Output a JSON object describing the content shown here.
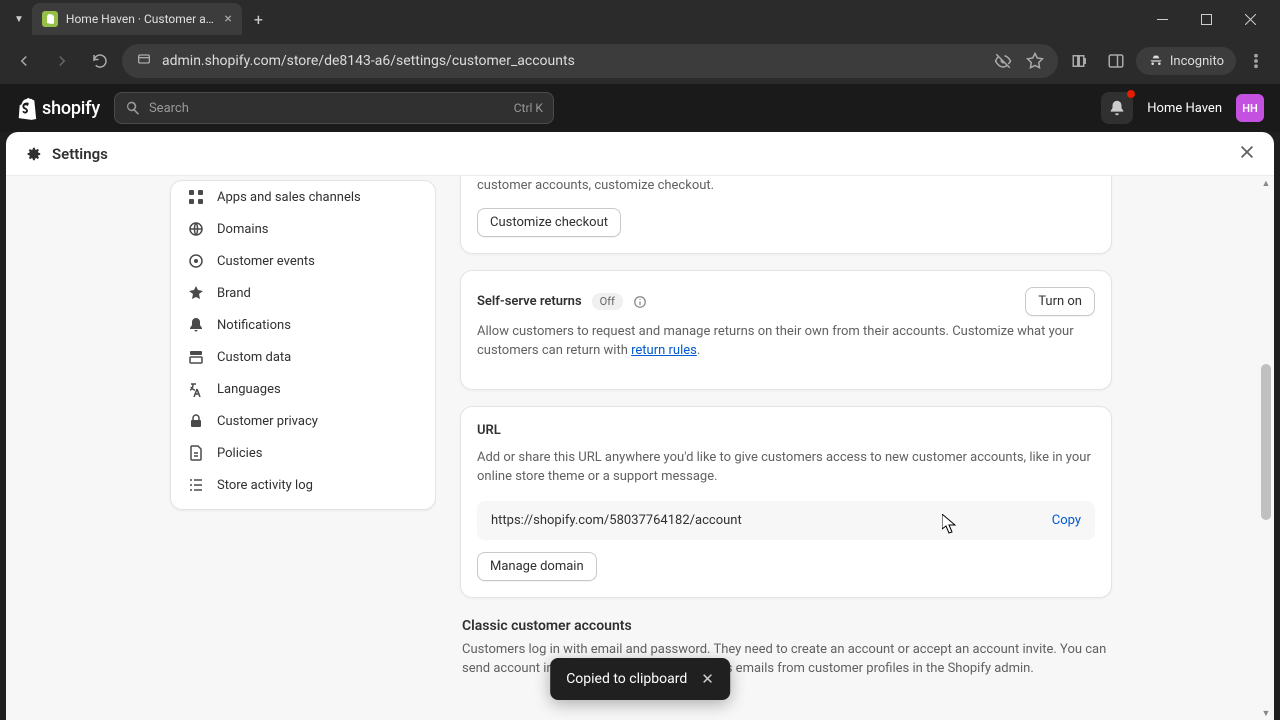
{
  "browser": {
    "tab_title": "Home Haven · Customer accou",
    "url": "admin.shopify.com/store/de8143-a6/settings/customer_accounts",
    "incognito_label": "Incognito"
  },
  "topbar": {
    "logo_text": "shopify",
    "search_placeholder": "Search",
    "search_shortcut": "Ctrl K",
    "store_name": "Home Haven",
    "avatar_initials": "HH"
  },
  "settings": {
    "title": "Settings"
  },
  "sidebar": {
    "items": [
      {
        "label": "Apps and sales channels"
      },
      {
        "label": "Domains"
      },
      {
        "label": "Customer events"
      },
      {
        "label": "Brand"
      },
      {
        "label": "Notifications"
      },
      {
        "label": "Custom data"
      },
      {
        "label": "Languages"
      },
      {
        "label": "Customer privacy"
      },
      {
        "label": "Policies"
      },
      {
        "label": "Store activity log"
      }
    ]
  },
  "cards": {
    "checkout": {
      "desc_fragment": "customer accounts, customize checkout.",
      "button": "Customize checkout"
    },
    "returns": {
      "title": "Self-serve returns",
      "badge": "Off",
      "turn_on": "Turn on",
      "desc_pre": "Allow customers to request and manage returns on their own from their accounts. Customize what your customers can return with ",
      "link": "return rules",
      "desc_post": "."
    },
    "url": {
      "title": "URL",
      "desc": "Add or share this URL anywhere you'd like to give customers access to new customer accounts, like in your online store theme or a support message.",
      "value": "https://shopify.com/58037764182/account",
      "copy": "Copy",
      "manage": "Manage domain"
    },
    "classic": {
      "title": "Classic customer accounts",
      "desc": "Customers log in with email and password. They need to create an account or accept an account invite. You can send account invites one at a time or in bulk as emails from customer profiles in the Shopify admin."
    }
  },
  "toast": {
    "message": "Copied to clipboard"
  }
}
